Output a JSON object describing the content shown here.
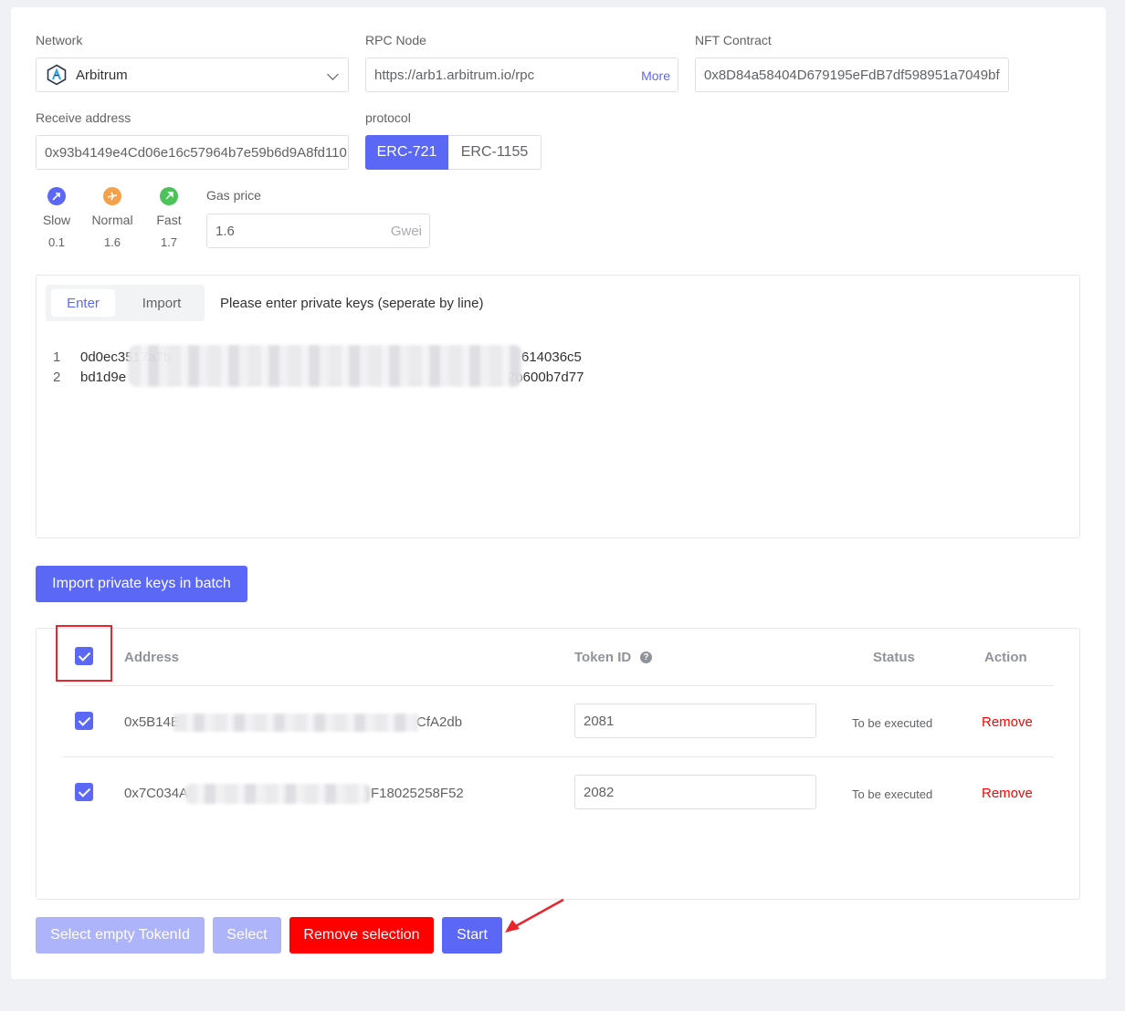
{
  "form": {
    "network": {
      "label": "Network",
      "value": "Arbitrum"
    },
    "rpc": {
      "label": "RPC Node",
      "value": "https://arb1.arbitrum.io/rpc",
      "more": "More"
    },
    "contract": {
      "label": "NFT Contract",
      "value": "0x8D84a58404D679195eFdB7df598951a7049bf"
    },
    "receive": {
      "label": "Receive address",
      "value": "0x93b4149e4Cd06e16c57964b7e59b6d9A8fd110"
    },
    "protocol": {
      "label": "protocol",
      "options": [
        "ERC-721",
        "ERC-1155"
      ],
      "selected": "ERC-721"
    },
    "gas": {
      "levels": [
        {
          "name": "Slow",
          "value": "0.1",
          "icon": "slow-icon",
          "color": "#5b67f5"
        },
        {
          "name": "Normal",
          "value": "1.6",
          "icon": "plane-icon",
          "color": "#f5a04a"
        },
        {
          "name": "Fast",
          "value": "1.7",
          "icon": "rocket-icon",
          "color": "#4cc25a"
        }
      ],
      "label": "Gas price",
      "value": "1.6",
      "unit": "Gwei"
    }
  },
  "keys": {
    "tabs": [
      "Enter",
      "Import"
    ],
    "active_tab": "Enter",
    "hint": "Please enter private keys (seperate by line)",
    "lines": [
      {
        "num": "1",
        "start": "0d0ec3517a7b",
        "end": "614036c5"
      },
      {
        "num": "2",
        "start": "bd1d9e",
        "end": "2b600b7d77"
      }
    ]
  },
  "import_button": "Import private keys in batch",
  "table": {
    "headers": {
      "address": "Address",
      "token_id": "Token ID",
      "status": "Status",
      "action": "Action"
    },
    "rows": [
      {
        "address_start": "0x5B14E",
        "address_end": "CfA2db",
        "token_id": "2081",
        "status": "To be executed",
        "action": "Remove"
      },
      {
        "address_start": "0x7C034A",
        "address_end": "F18025258F52",
        "token_id": "2082",
        "status": "To be executed",
        "action": "Remove"
      }
    ]
  },
  "actions": {
    "select_empty": "Select empty TokenId",
    "select": "Select",
    "remove_selection": "Remove selection",
    "start": "Start"
  },
  "colors": {
    "primary": "#5b67f5",
    "primary_light": "#aeb4fa",
    "danger": "#ff0000",
    "annotation": "#e8242c"
  }
}
